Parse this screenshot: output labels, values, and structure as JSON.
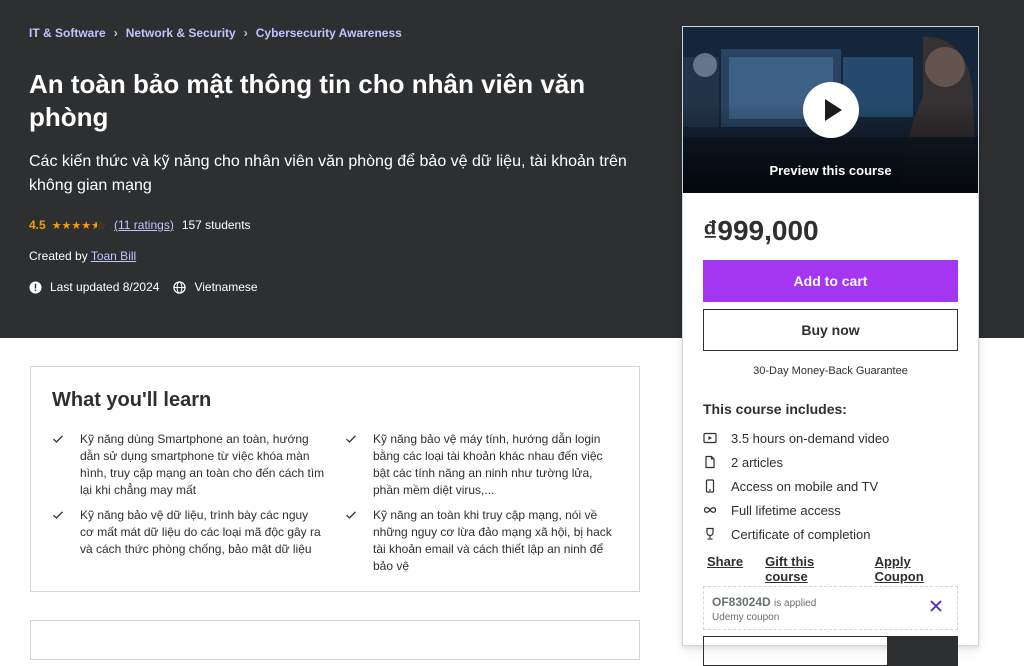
{
  "breadcrumb": [
    "IT & Software",
    "Network & Security",
    "Cybersecurity Awareness"
  ],
  "course": {
    "title": "An toàn bảo mật thông tin cho nhân viên văn phòng",
    "subtitle": "Các kiến thức và kỹ năng cho nhân viên văn phòng để bảo vệ dữ liệu, tài khoản trên không gian mạng",
    "rating": "4.5",
    "rating_value": 4.5,
    "ratings_link": "(11 ratings)",
    "students": "157 students",
    "created_by_label": "Created by",
    "instructor": "Toan Bill",
    "last_updated": "Last updated 8/2024",
    "language": "Vietnamese"
  },
  "card": {
    "preview_label": "Preview this course",
    "price": "₫999,000",
    "add_to_cart": "Add to cart",
    "buy_now": "Buy now",
    "guarantee": "30-Day Money-Back Guarantee",
    "includes_title": "This course includes:",
    "includes": [
      {
        "icon": "video-icon",
        "text": "3.5 hours on-demand video"
      },
      {
        "icon": "file-icon",
        "text": "2 articles"
      },
      {
        "icon": "mobile-icon",
        "text": "Access on mobile and TV"
      },
      {
        "icon": "infinity-icon",
        "text": "Full lifetime access"
      },
      {
        "icon": "trophy-icon",
        "text": "Certificate of completion"
      }
    ],
    "links": [
      "Share",
      "Gift this course",
      "Apply Coupon"
    ],
    "coupon_code": "OF83024D",
    "coupon_applied": "is applied",
    "coupon_source": "Udemy coupon"
  },
  "learn": {
    "title": "What you'll learn",
    "items": [
      "Kỹ năng dùng Smartphone an toàn, hướng dẫn sử dụng smartphone từ việc khóa màn hình, truy cập mạng an toàn cho đến cách tìm lại khi chẳng may mất",
      "Kỹ năng bảo vệ máy tính, hướng dẫn login bằng các loại tài khoản khác nhau đến việc bật các tính năng an ninh như tường lửa, phần mềm diệt virus,...",
      "Kỹ năng bảo vệ dữ liệu, trình bày các nguy cơ mất mát dữ liệu do các loại mã độc gây ra và cách thức phòng chống, bảo mật dữ liệu",
      "Kỹ năng an toàn khi truy cập mạng, nói về những nguy cơ lừa đảo mạng xã hội, bị hack tài khoản email và cách thiết lập an ninh để bảo vệ"
    ]
  },
  "colors": {
    "hero_bg": "#2d2f31",
    "accent": "#a435f0",
    "link": "#c0c4fc",
    "star": "#f69c08"
  }
}
